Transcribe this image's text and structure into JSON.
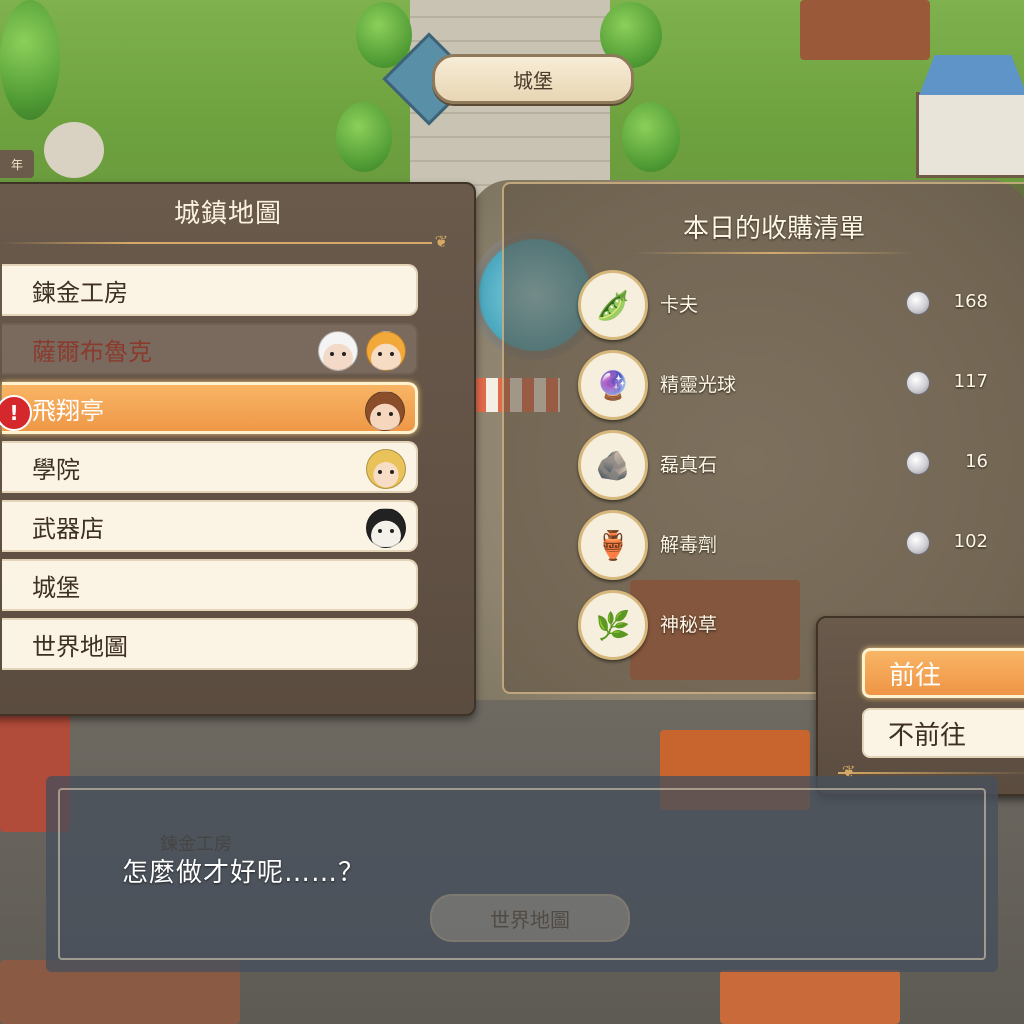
{
  "signpost": {
    "label": "城堡"
  },
  "corner_tag": "年",
  "town_map": {
    "title": "城鎮地圖",
    "locations": [
      {
        "label": "鍊金工房",
        "state": "normal",
        "faces": []
      },
      {
        "label": "薩爾布魯克",
        "state": "disabled",
        "faces": [
          "white-haired-face-icon",
          "blonde-face-icon"
        ]
      },
      {
        "label": "飛翔亭",
        "state": "selected",
        "alert": "!",
        "faces": [
          "brown-haired-face-icon"
        ]
      },
      {
        "label": "學院",
        "state": "normal",
        "faces": [
          "long-blonde-face-icon"
        ]
      },
      {
        "label": "武器店",
        "state": "normal",
        "faces": [
          "dark-haired-face-icon"
        ]
      },
      {
        "label": "城堡",
        "state": "normal",
        "faces": []
      },
      {
        "label": "世界地圖",
        "state": "normal",
        "faces": []
      }
    ]
  },
  "purchase_list": {
    "title": "本日的收購清單",
    "items": [
      {
        "name": "卡夫",
        "price": "168",
        "icon": "green-bean-pods-icon"
      },
      {
        "name": "精靈光球",
        "price": "117",
        "icon": "spirit-orbs-icon"
      },
      {
        "name": "磊真石",
        "price": "16",
        "icon": "ore-stones-icon"
      },
      {
        "name": "解毒劑",
        "price": "102",
        "icon": "antidote-jar-icon"
      },
      {
        "name": "神秘草",
        "price": "",
        "icon": "mystic-herb-icon"
      }
    ]
  },
  "choice": {
    "go_label": "前往",
    "stay_label": "不前往"
  },
  "dialog": {
    "text": "怎麼做才好呢……？"
  },
  "background_signs": {
    "bottom": "世界地圖",
    "faded": "鍊金工房"
  },
  "colors": {
    "accent": "#ef9546",
    "panel": "#5b4c40",
    "item_bg": "#fbf3e3",
    "alert": "#d5282c"
  }
}
